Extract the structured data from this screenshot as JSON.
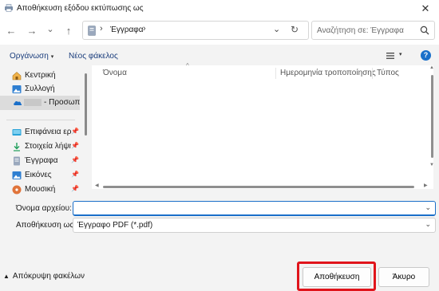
{
  "window": {
    "title": "Αποθήκευση εξόδου εκτύπωσης ως",
    "close_glyph": "✕"
  },
  "nav": {
    "back_glyph": "←",
    "forward_glyph": "→",
    "recent_glyph": "⌄",
    "up_glyph": "↑",
    "refresh_glyph": "↻"
  },
  "address": {
    "separator": "›",
    "crumb": "Έγγραφα",
    "dropdown_glyph": "⌄"
  },
  "search": {
    "placeholder": "Αναζήτηση σε: Έγγραφα"
  },
  "commands": {
    "organize": "Οργάνωση",
    "new_folder": "Νέος φάκελος",
    "caret": "▾"
  },
  "sidebar": {
    "items": [
      {
        "label": "Κεντρική",
        "icon": "home-icon"
      },
      {
        "label": "Συλλογή",
        "icon": "gallery-icon"
      },
      {
        "label": "- Προσωπικό",
        "icon": "onedrive-icon"
      },
      {
        "label": "Επιφάνεια εργ",
        "icon": "desktop-icon"
      },
      {
        "label": "Στοιχεία λήψη",
        "icon": "downloads-icon"
      },
      {
        "label": "Έγγραφα",
        "icon": "documents-icon"
      },
      {
        "label": "Εικόνες",
        "icon": "pictures-icon"
      },
      {
        "label": "Μουσική",
        "icon": "music-icon"
      }
    ],
    "pin_glyph": "📌"
  },
  "columns": {
    "name": "Όνομα",
    "modified": "Ημερομηνία τροποποίησης",
    "type": "Τύπος",
    "sort_glyph": "^"
  },
  "form": {
    "filename_label": "Όνομα αρχείου:",
    "filename_value": "",
    "savetype_label": "Αποθήκευση ως:",
    "savetype_value": "Έγγραφο PDF (*.pdf)",
    "dropdown_glyph": "⌄"
  },
  "footer": {
    "hide_folders": "Απόκρυψη φακέλων",
    "hide_glyph": "▲",
    "save": "Αποθήκευση",
    "cancel": "Άκυρο"
  },
  "colors": {
    "accent": "#1a6fc9",
    "highlight": "#e0141b"
  }
}
